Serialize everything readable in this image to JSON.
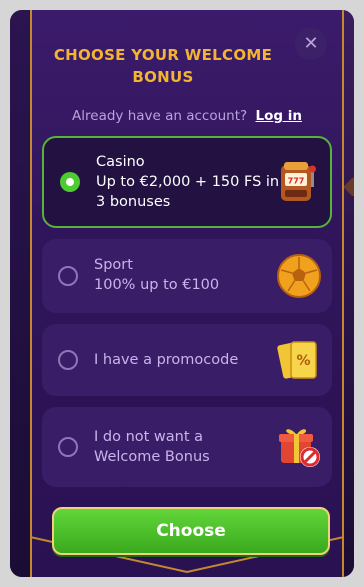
{
  "modal": {
    "title": "CHOOSE YOUR WELCOME BONUS",
    "close_label": "✕",
    "account_prompt": "Already have an account?",
    "login_link": "Log in"
  },
  "options": [
    {
      "title": "Casino",
      "subtitle": "Up to €2,000 + 150 FS in 3 bonuses",
      "selected": true,
      "icon": "slot-machine-icon"
    },
    {
      "title": "Sport",
      "subtitle": "100% up to €100",
      "selected": false,
      "icon": "soccer-ball-icon"
    },
    {
      "title": "I have a promocode",
      "subtitle": "",
      "selected": false,
      "icon": "promo-ticket-icon"
    },
    {
      "title": "I do not want a Welcome Bonus",
      "subtitle": "",
      "selected": false,
      "icon": "gift-no-icon"
    }
  ],
  "choose_button": "Choose",
  "colors": {
    "title": "#f3b531",
    "selected_border": "#57b33a",
    "radio_checked": "#4ecb2f",
    "button_green": "#3aa91e",
    "modal_border": "#c4892f"
  }
}
